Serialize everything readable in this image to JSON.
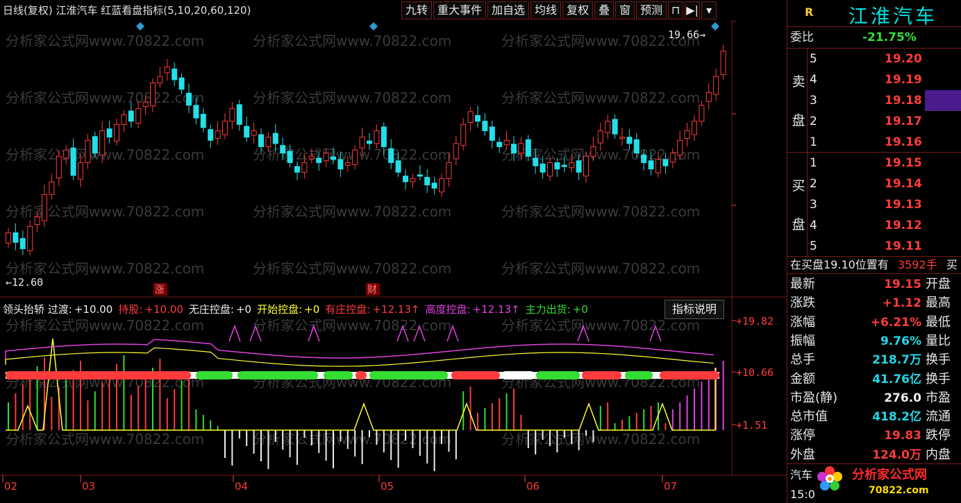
{
  "header": {
    "title": "日线(复权)   江淮汽车  红蓝看盘指标(5,10,20,60,120)",
    "toolbar": [
      "九转",
      "重大事件",
      "加自选",
      "均线",
      "复权",
      "叠",
      "窗",
      "预测"
    ],
    "toolbar_flags": [
      true,
      true,
      true,
      false,
      false,
      false,
      false,
      false
    ]
  },
  "chart": {
    "price_axis": [
      "20.05",
      "17.44",
      "14.81"
    ],
    "high_label": "19.66",
    "low_label": "12.60",
    "event_marks": [
      "涨",
      "财"
    ],
    "watermark": "分析家公式网www.70822.com",
    "indicator_axis": [
      "+19.82",
      "+10.66",
      "+1.51"
    ],
    "dates": [
      "02",
      "03",
      "04",
      "05",
      "06",
      "07"
    ]
  },
  "indicator": {
    "legend": [
      {
        "label": "领头抬轿 过渡:",
        "value": "+10.00",
        "color": "#eeeeee"
      },
      {
        "label": "持股:",
        "value": "+10.00",
        "color": "#ff3b3b"
      },
      {
        "label": "无庄控盘:",
        "value": "+0",
        "color": "#eeeeee"
      },
      {
        "label": "开始控盘:",
        "value": "+0",
        "color": "#ffff33"
      },
      {
        "label": "有庄控盘:",
        "value": "+12.13↑",
        "color": "#ff3b3b"
      },
      {
        "label": "高度控盘:",
        "value": "+12.13↑",
        "color": "#e040e0"
      },
      {
        "label": "主力出货:",
        "value": "+0",
        "color": "#33dd33"
      }
    ],
    "help_button": "指标说明"
  },
  "panel": {
    "r_label": "R",
    "stock_name": "江淮汽车",
    "weibi_label": "委比",
    "weibi_value": "-21.75%",
    "sell_side": "卖盘",
    "buy_side": "买盘",
    "sell": [
      {
        "level": "5",
        "price": "19.20"
      },
      {
        "level": "4",
        "price": "19.19"
      },
      {
        "level": "3",
        "price": "19.18"
      },
      {
        "level": "2",
        "price": "19.17"
      },
      {
        "level": "1",
        "price": "19.16"
      }
    ],
    "buy": [
      {
        "level": "1",
        "price": "19.15"
      },
      {
        "level": "2",
        "price": "19.14"
      },
      {
        "level": "3",
        "price": "19.13"
      },
      {
        "level": "4",
        "price": "19.12"
      },
      {
        "level": "5",
        "price": "19.11"
      }
    ],
    "notice": "在买盘19.10位置有",
    "notice_vol": "3592手",
    "notice_tail": "买",
    "stats": [
      {
        "label": "最新",
        "value": "19.15",
        "color": "#ff3b3b",
        "label2": "开盘"
      },
      {
        "label": "涨跌",
        "value": "+1.12",
        "color": "#ff3b3b",
        "label2": "最高"
      },
      {
        "label": "涨幅",
        "value": "+6.21%",
        "color": "#ff3b3b",
        "label2": "最低"
      },
      {
        "label": "振幅",
        "value": "9.76%",
        "color": "#22d8e8",
        "label2": "量比"
      },
      {
        "label": "总手",
        "value": "218.7万",
        "color": "#22d8e8",
        "label2": "换手"
      },
      {
        "label": "金额",
        "value": "41.76亿",
        "color": "#22d8e8",
        "label2": "换手"
      },
      {
        "label": "市盈(静)",
        "value": "276.0",
        "color": "#eeeeee",
        "label2": "市盈"
      },
      {
        "label": "总市值",
        "value": "418.2亿",
        "color": "#22d8e8",
        "label2": "流通"
      },
      {
        "label": "涨停",
        "value": "19.83",
        "color": "#ff3b3b",
        "label2": "跌停"
      },
      {
        "label": "外盘",
        "value": "124.0万",
        "color": "#ff3b3b",
        "label2": "内盘"
      }
    ],
    "bottom_tab": "汽车",
    "bottom_time": "15:0",
    "logo_text": "分析家公式网",
    "logo_url": "70822.com"
  }
}
